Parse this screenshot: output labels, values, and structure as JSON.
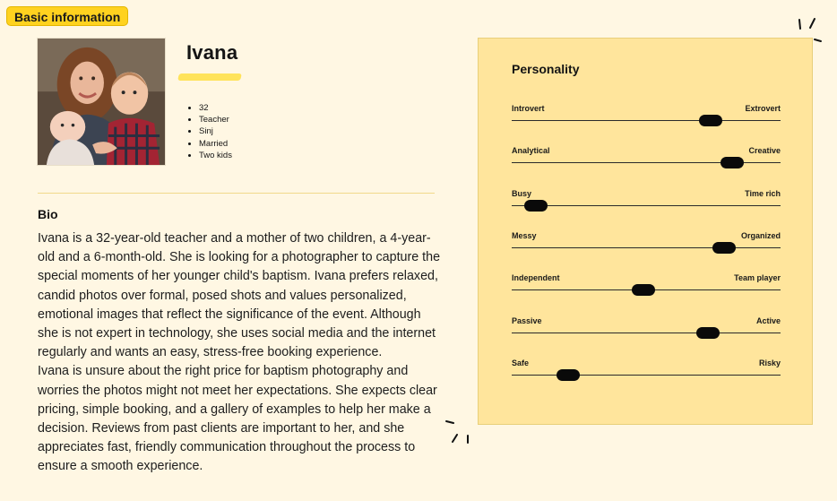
{
  "badge": {
    "label": "Basic information"
  },
  "persona": {
    "name": "Ivana",
    "facts": [
      "32",
      "Teacher",
      "Sinj",
      "Married",
      "Two kids"
    ]
  },
  "bio": {
    "title": "Bio",
    "paragraph1": "Ivana is a 32-year-old teacher and a mother of two children, a 4-year-old and a 6-month-old. She is looking for a photographer to capture the special moments of her younger child's baptism. Ivana prefers relaxed, candid photos over formal, posed shots and values personalized, emotional images that reflect the significance of the event. Although she is not expert in technology, she uses social media and the internet regularly and wants an easy, stress-free booking experience.",
    "paragraph2": "Ivana is unsure about the right price for baptism photography and worries the photos might not meet her expectations. She expects clear pricing, simple booking, and a gallery of examples to help her make a decision. Reviews from past clients are important to her, and she appreciates fast, friendly communication throughout the process to ensure a smooth experience."
  },
  "personality": {
    "title": "Personality",
    "traits": [
      {
        "left": "Introvert",
        "right": "Extrovert",
        "value": 0.74
      },
      {
        "left": "Analytical",
        "right": "Creative",
        "value": 0.82
      },
      {
        "left": "Busy",
        "right": "Time rich",
        "value": 0.09
      },
      {
        "left": "Messy",
        "right": "Organized",
        "value": 0.79
      },
      {
        "left": "Independent",
        "right": "Team player",
        "value": 0.49
      },
      {
        "left": "Passive",
        "right": "Active",
        "value": 0.73
      },
      {
        "left": "Safe",
        "right": "Risky",
        "value": 0.21
      }
    ]
  },
  "colors": {
    "background": "#fff7e3",
    "badge": "#ffd21f",
    "panel": "#ffe59c",
    "highlight": "#ffe35a",
    "slider_knob": "#0a0a0a"
  }
}
